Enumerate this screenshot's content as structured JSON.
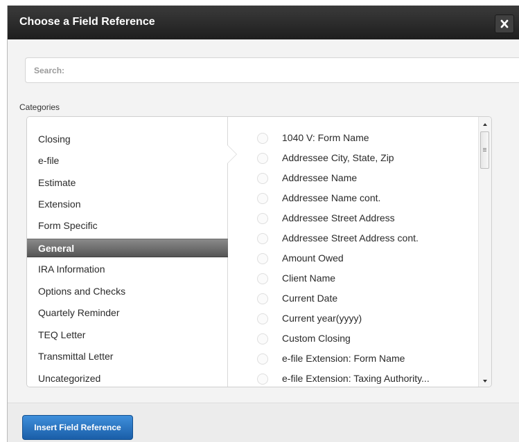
{
  "dialog": {
    "title": "Choose a Field Reference",
    "close_icon": "close-icon"
  },
  "search": {
    "placeholder": "Search:",
    "value": ""
  },
  "categories": {
    "label": "Categories",
    "selected": "General",
    "items": [
      {
        "label": "Closing"
      },
      {
        "label": "e-file"
      },
      {
        "label": "Estimate"
      },
      {
        "label": "Extension"
      },
      {
        "label": "Form Specific"
      },
      {
        "label": "General"
      },
      {
        "label": "IRA Information"
      },
      {
        "label": "Options and Checks"
      },
      {
        "label": "Quartely Reminder"
      },
      {
        "label": "TEQ Letter"
      },
      {
        "label": "Transmittal Letter"
      },
      {
        "label": "Uncategorized"
      }
    ]
  },
  "fields": {
    "items": [
      {
        "label": "1040 V: Form Name"
      },
      {
        "label": "Addressee City, State, Zip"
      },
      {
        "label": "Addressee Name"
      },
      {
        "label": "Addressee Name cont."
      },
      {
        "label": "Addressee Street Address"
      },
      {
        "label": "Addressee Street Address cont."
      },
      {
        "label": "Amount Owed"
      },
      {
        "label": "Client Name"
      },
      {
        "label": "Current Date"
      },
      {
        "label": "Current year(yyyy)"
      },
      {
        "label": "Custom Closing"
      },
      {
        "label": "e-file Extension: Form Name"
      },
      {
        "label": "e-file Extension: Taxing Authority..."
      }
    ]
  },
  "footer": {
    "insert_label": "Insert Field Reference"
  },
  "colors": {
    "titlebar": "#2b2b2b",
    "selected_category": "#6a6a6a",
    "primary_button": "#2a74c4"
  }
}
